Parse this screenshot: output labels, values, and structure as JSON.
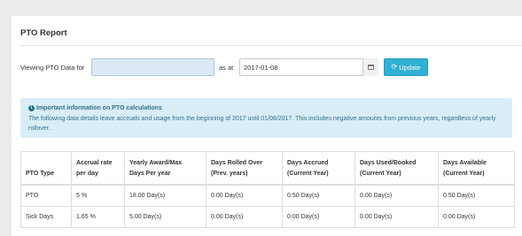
{
  "report": {
    "title": "PTO Report"
  },
  "filter": {
    "viewing_label": "Viewing PTO Data for",
    "employee_value": "",
    "as_at_label": "as at",
    "date_value": "2017-01-08",
    "calendar_icon": "calendar-icon",
    "update_icon": "refresh-icon",
    "update_label": "Update"
  },
  "info": {
    "icon": "info-circle-icon",
    "title": "Important information on PTO calculations",
    "text": "The following data details leave accruals and usage from the beginning of 2017 until 01/08/2017. This includes negative amounts from previous years, regardless of yearly rollover."
  },
  "table": {
    "headers": [
      [
        "PTO Type"
      ],
      [
        "Accrual rate",
        "per day"
      ],
      [
        "Yearly Award/Max",
        "Days Per year"
      ],
      [
        "Days Rolled Over",
        "(Prev. years)"
      ],
      [
        "Days Accrued",
        "(Current Year)"
      ],
      [
        "Days Used/Booked",
        "(Current Year)"
      ],
      [
        "Days Available",
        "(Current Year)"
      ]
    ],
    "rows": [
      [
        "PTO",
        "5 %",
        "18.00 Day(s)",
        "0.00 Day(s)",
        "0.50 Day(s)",
        "0.00 Day(s)",
        "0.50 Day(s)"
      ],
      [
        "Sick Days",
        "1.65 %",
        "5.00 Day(s)",
        "0.00 Day(s)",
        "0.00 Day(s)",
        "0.00 Day(s)",
        "0.00 Day(s)"
      ]
    ]
  },
  "colors": {
    "page_background": "#ececec",
    "info_background": "#d9edf7",
    "info_text": "#31708f",
    "button": "#31b0d5",
    "selected_input": "#dde9f6"
  }
}
